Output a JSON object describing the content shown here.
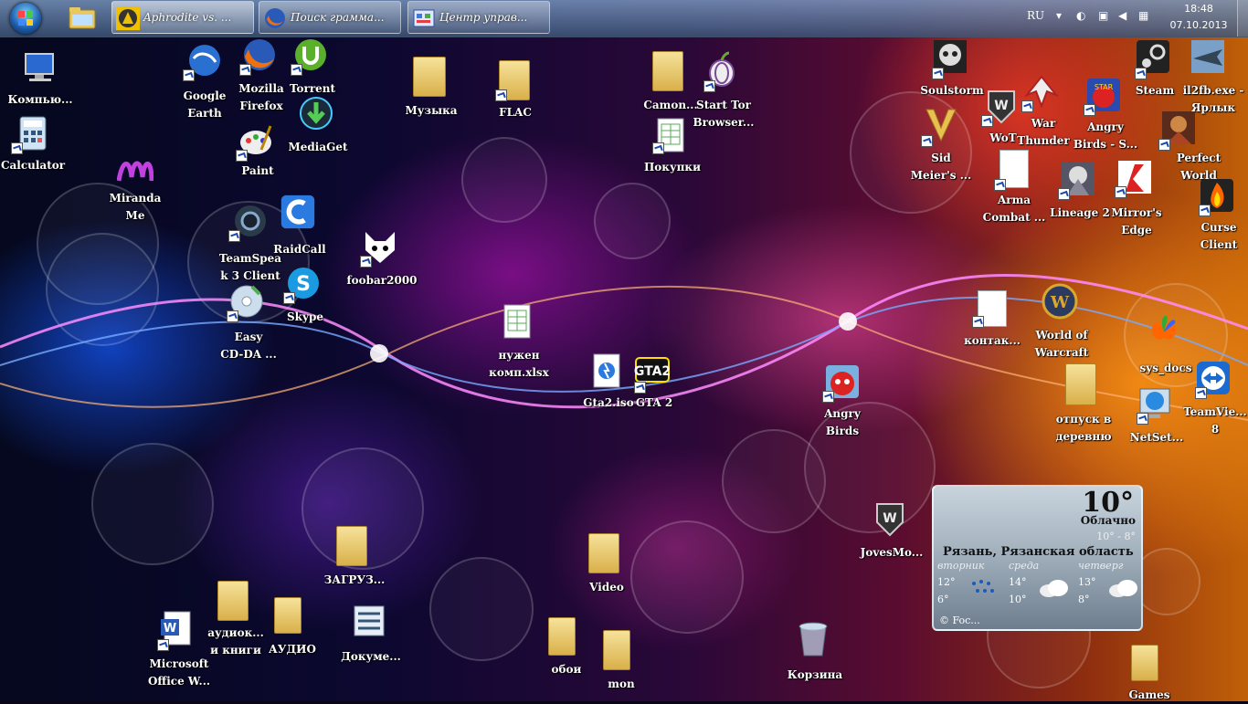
{
  "taskbar": {
    "tasks": [
      {
        "label": "Aphrodite vs. ...",
        "active": true
      },
      {
        "label": "Поиск грамма...",
        "active": false
      },
      {
        "label": "Центр управ...",
        "active": false
      }
    ],
    "tray": {
      "lang": "RU",
      "time": "18:48",
      "date": "07.10.2013"
    }
  },
  "icons": {
    "computer": "Компью...",
    "calculator": "Calculator",
    "google_earth": "Google\nEarth",
    "firefox": "Mozilla\nFirefox",
    "utorrent": "Torrent",
    "mediaget": "MediaGet",
    "paint": "Paint",
    "miranda": "Miranda\nMe",
    "teamspeak": "TeamSpea\nk 3 Client",
    "raidcall": "RaidCall",
    "skype": "Skype",
    "easycd": "Easy\nCD-DA ...",
    "foobar": "foobar2000",
    "music": "Музыка",
    "flac": "FLAC",
    "camon": "Camon...",
    "tor": "Start Tor\nBrowser...",
    "pokupki": "Покупки",
    "xlsx": "нужен\nкомп.xlsx",
    "gta2iso": "Gta2.iso",
    "gta2": "GTA 2",
    "angry_birds": "Angry\nBirds",
    "zagruzki": "ЗАГРУЗ...",
    "audiobooks": "аудиок...\nи книги",
    "audio": "АУДИО",
    "documents": "Докуме...",
    "msoffice": "Microsoft\nOffice W...",
    "video": "Video",
    "oboi": "обои",
    "mon": "mon",
    "recycle": "Корзина",
    "jovesmo": "JovesMo...",
    "games": "Games",
    "soulstorm": "Soulstorm",
    "steam": "Steam",
    "il2fb": "il2fb.exe -\nЯрлык",
    "sid_meier": "Sid\nMeier's ...",
    "wot": "WoT",
    "war_thunder": "War\nThunder",
    "angry_birds_sw": "Angry\nBirds - S...",
    "perfect_world": "Perfect\nWorld",
    "arma": "Arma\nCombat ...",
    "lineage": "Lineage 2",
    "mirrors_edge": "Mirror's\nEdge",
    "curse": "Curse\nClient",
    "kontakt": "контак...",
    "wow": "World of\nWarcraft",
    "sysdocs": "sys_docs",
    "otpusk": "отпуск в\nдеревню",
    "netset": "NetSet...",
    "teamviewer": "TeamVie...\n8"
  },
  "weather": {
    "temp": "10°",
    "condition": "Облачно",
    "range": "10° - 8°",
    "city": "Рязань, Рязанская область",
    "days": [
      {
        "name": "вторник",
        "hi": "12°",
        "lo": "6°",
        "icon": "rain-icon"
      },
      {
        "name": "среда",
        "hi": "14°",
        "lo": "10°",
        "icon": "cloud-icon"
      },
      {
        "name": "четверг",
        "hi": "13°",
        "lo": "8°",
        "icon": "cloud-icon"
      }
    ],
    "source": "© Foc..."
  }
}
